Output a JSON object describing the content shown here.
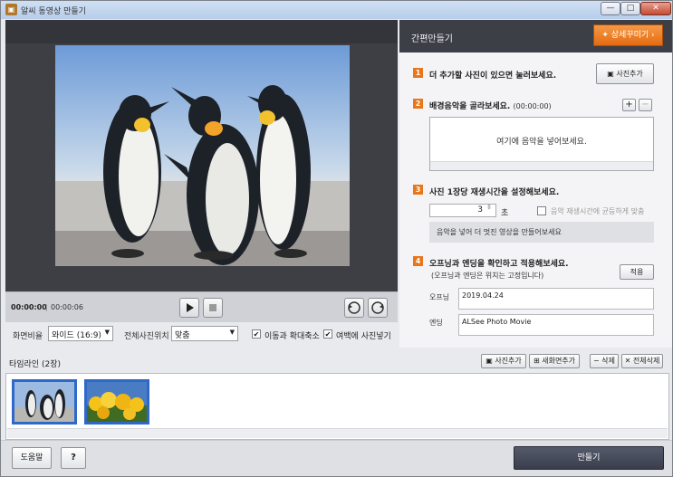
{
  "window": {
    "title": "알씨 동영상 만들기",
    "min": "—",
    "max": "□",
    "close": "✕"
  },
  "player": {
    "current_time": "00:00:00",
    "separator": "|",
    "total_time": "00:00:06"
  },
  "options": {
    "ratio_label": "화면비율",
    "ratio_value": "와이드 (16:9)",
    "position_label": "전체사진위치",
    "position_value": "맞춤",
    "zoom_label": "이동과 확대축소",
    "zoom_checked": true,
    "margin_label": "여백에 사진넣기",
    "margin_checked": true
  },
  "panel": {
    "title": "간편만들기",
    "detail_button": "상세꾸미기",
    "steps": [
      {
        "num": "1",
        "title": "더 추가할 사진이 있으면 눌러보세요.",
        "button": "사진추가"
      },
      {
        "num": "2",
        "title": "배경음악을 골라보세요.",
        "sub": "(00:00:00)",
        "hint": "여기에 음악을 넣어보세요."
      },
      {
        "num": "3",
        "title": "사진 1장당 재생시간을 설정해보세요.",
        "seconds": "3",
        "unit": "초",
        "equal_label": "음악 재생시간에 균등하게 맞춤",
        "note": "음악을 넣어 더 멋진 영상을 만들어보세요"
      },
      {
        "num": "4",
        "title": "오프닝과 엔딩을 확인하고 적용해보세요.",
        "sub": "(오프닝과 엔딩은 위치는 고정입니다)",
        "apply": "적용",
        "opening_label": "오프닝",
        "opening_value": "2019.04.24",
        "ending_label": "엔딩",
        "ending_value": "ALSee Photo Movie"
      }
    ]
  },
  "timeline": {
    "title": "타임라인 (2장)",
    "add_photo": "사진추가",
    "new_scene": "새화면추가",
    "delete": "삭제",
    "delete_all": "전체삭제"
  },
  "footer": {
    "help": "도움말",
    "question": "?",
    "make": "만들기"
  }
}
